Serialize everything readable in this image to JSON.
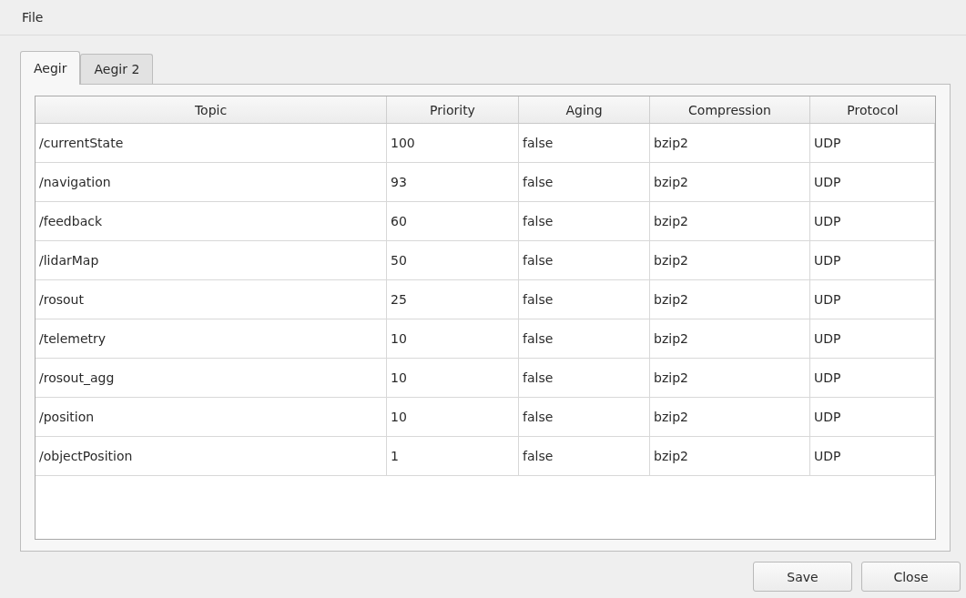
{
  "menu": [
    "File"
  ],
  "tabs": [
    {
      "label": "Aegir",
      "selected": true
    },
    {
      "label": "Aegir 2",
      "selected": false
    }
  ],
  "table": {
    "columns": [
      "Topic",
      "Priority",
      "Aging",
      "Compression",
      "Protocol"
    ],
    "rows": [
      [
        "/currentState",
        "100",
        "false",
        "bzip2",
        "UDP"
      ],
      [
        "/navigation",
        "93",
        "false",
        "bzip2",
        "UDP"
      ],
      [
        "/feedback",
        "60",
        "false",
        "bzip2",
        "UDP"
      ],
      [
        "/lidarMap",
        "50",
        "false",
        "bzip2",
        "UDP"
      ],
      [
        "/rosout",
        "25",
        "false",
        "bzip2",
        "UDP"
      ],
      [
        "/telemetry",
        "10",
        "false",
        "bzip2",
        "UDP"
      ],
      [
        "/rosout_agg",
        "10",
        "false",
        "bzip2",
        "UDP"
      ],
      [
        "/position",
        "10",
        "false",
        "bzip2",
        "UDP"
      ],
      [
        "/objectPosition",
        "1",
        "false",
        "bzip2",
        "UDP"
      ]
    ]
  },
  "buttons": [
    "Save",
    "Close"
  ]
}
